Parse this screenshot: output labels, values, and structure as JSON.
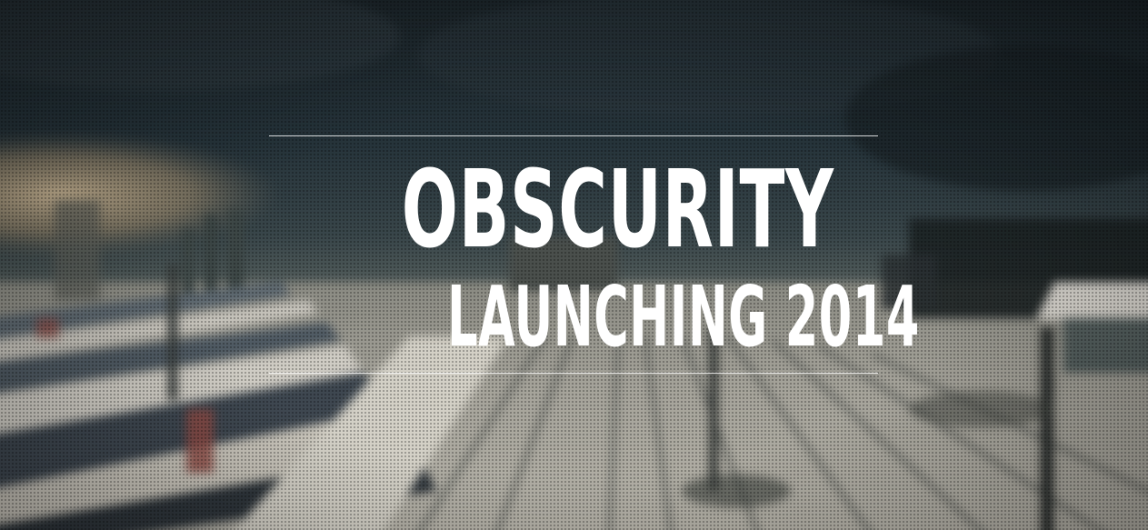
{
  "hero": {
    "title": "OBSCURITY",
    "subtitle": "LAUNCHING 2014",
    "background_image": "blurred-railway-yard-photo"
  },
  "colors": {
    "text": "#ffffff",
    "sky_dark": "#1f2a30",
    "haze": "#b9a88a",
    "ground": "#a9a79c"
  }
}
